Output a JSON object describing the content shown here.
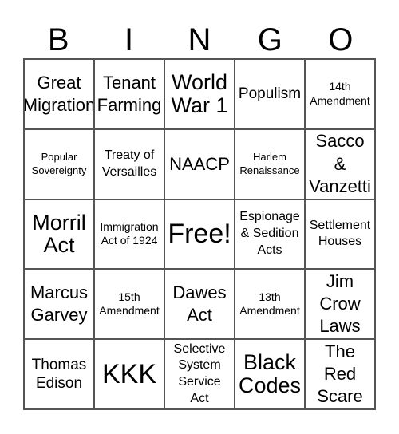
{
  "header": {
    "letters": [
      "B",
      "I",
      "N",
      "G",
      "O"
    ]
  },
  "cells": [
    [
      "Great\nMigration",
      "Tenant\nFarming",
      "World\nWar 1",
      "Populism",
      "14th\nAmendment"
    ],
    [
      "Popular\nSovereignty",
      "Treaty of\nVersailles",
      "NAACP",
      "Harlem\nRenaissance",
      "Sacco\n&\nVanzetti"
    ],
    [
      "Morril\nAct",
      "Immigration\nAct of 1924",
      "Free!",
      "Espionage\n& Sedition\nActs",
      "Settlement\nHouses"
    ],
    [
      "Marcus\nGarvey",
      "15th\nAmendment",
      "Dawes\nAct",
      "13th\nAmendment",
      "Jim\nCrow\nLaws"
    ],
    [
      "Thomas\nEdison",
      "KKK",
      "Selective\nSystem\nService\nAct",
      "Black\nCodes",
      "The\nRed\nScare"
    ]
  ],
  "free_space": {
    "row": 2,
    "col": 2,
    "label": "Free!"
  }
}
